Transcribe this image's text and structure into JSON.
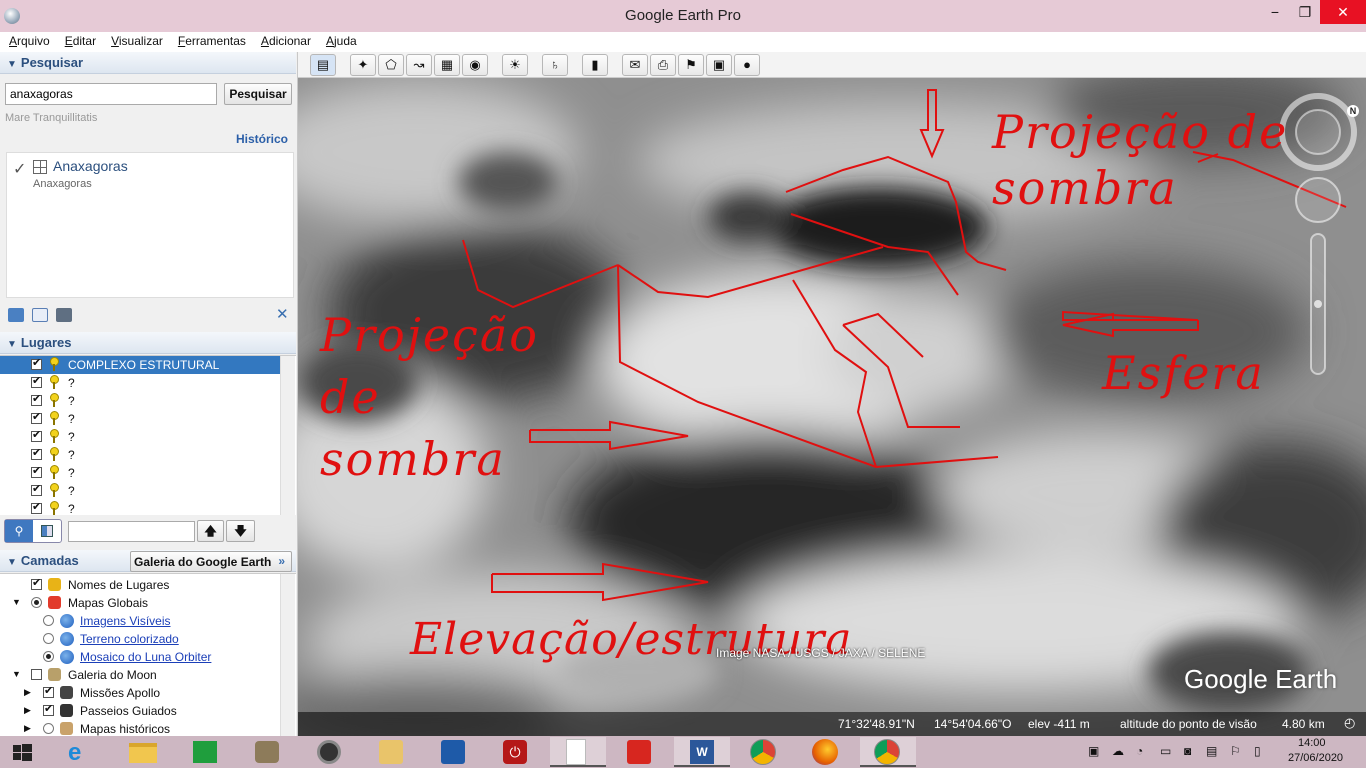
{
  "window": {
    "title": "Google Earth Pro",
    "min": "−",
    "max": "❐",
    "close": "✕"
  },
  "menu": [
    "Arquivo",
    "Editar",
    "Visualizar",
    "Ferramentas",
    "Adicionar",
    "Ajuda"
  ],
  "search": {
    "header": "Pesquisar",
    "query": "anaxagoras",
    "button": "Pesquisar",
    "hint": "Mare Tranquillitatis",
    "history_link": "Histórico",
    "result_title": "Anaxagoras",
    "result_subtitle": "Anaxagoras"
  },
  "places": {
    "header": "Lugares",
    "items": [
      {
        "label": "COMPLEXO ESTRUTURAL",
        "checked": true,
        "selected": true
      },
      {
        "label": "?",
        "checked": true
      },
      {
        "label": "?",
        "checked": true
      },
      {
        "label": "?",
        "checked": true
      },
      {
        "label": "?",
        "checked": true
      },
      {
        "label": "?",
        "checked": true
      },
      {
        "label": "?",
        "checked": true
      },
      {
        "label": "?",
        "checked": true
      },
      {
        "label": "?",
        "checked": true
      }
    ]
  },
  "layers": {
    "header": "Camadas",
    "gallery_button": "Galeria do Google Earth",
    "items": [
      {
        "label": "Nomes de Lugares",
        "kind": "checkbox",
        "checked": true
      },
      {
        "label": "Mapas Globais",
        "kind": "radio",
        "checked": true
      },
      {
        "label": "Imagens Visíveis",
        "kind": "radio",
        "checked": false,
        "link": true
      },
      {
        "label": "Terreno colorizado",
        "kind": "radio",
        "checked": false,
        "link": true
      },
      {
        "label": "Mosaico do Luna Orbiter",
        "kind": "radio",
        "checked": true,
        "link": true
      },
      {
        "label": "Galeria do Moon",
        "kind": "checkbox",
        "checked": false
      },
      {
        "label": "Missões Apollo",
        "kind": "checkbox",
        "checked": true
      },
      {
        "label": "Passeios Guiados",
        "kind": "checkbox",
        "checked": true
      },
      {
        "label": "Mapas históricos",
        "kind": "radio",
        "checked": false
      }
    ]
  },
  "map": {
    "annotations": {
      "shadow_top": [
        "Projeção de",
        "sombra"
      ],
      "shadow_left": [
        "Projeção",
        "de",
        "sombra"
      ],
      "sphere": "Esfera",
      "elevation": "Elevação/estrutura"
    },
    "credit": "Image NASA / USGS / JAXA / SELENE",
    "logo": "Google Earth",
    "compass_letter": "N",
    "annotation_color": "#e01010"
  },
  "status": {
    "lat": "71°32'48.91\"N",
    "lon": "14°54'04.66\"O",
    "elev": "elev  -411 m",
    "eye": "altitude do ponto de visão",
    "eye_value": "4.80 km"
  },
  "taskbar": {
    "time": "14:00",
    "date": "27/06/2020",
    "apps": [
      "internet-explorer",
      "file-explorer",
      "store",
      "app",
      "speaker",
      "documents",
      "task-app",
      "power",
      "blank-document",
      "acrobat",
      "word",
      "chrome",
      "firefox",
      "chrome-active"
    ]
  }
}
